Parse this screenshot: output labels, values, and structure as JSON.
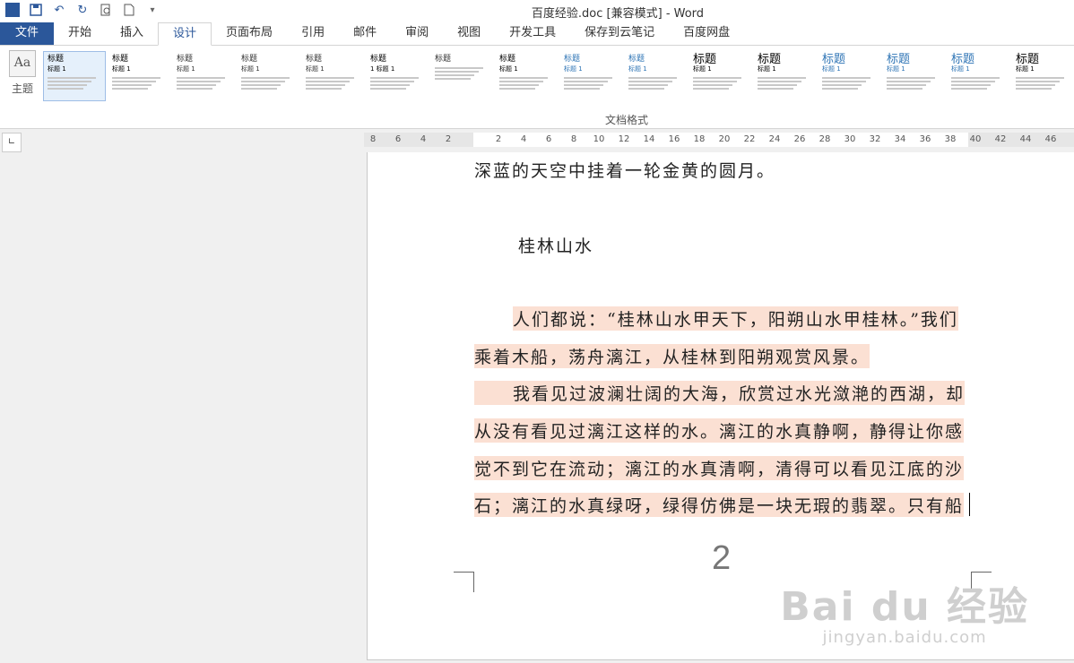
{
  "window": {
    "title": "百度经验.doc [兼容模式] - Word"
  },
  "qat": {
    "icons": [
      "word-logo",
      "save-icon",
      "undo-icon",
      "redo-icon",
      "print-preview-icon",
      "new-doc-icon",
      "customize-icon"
    ]
  },
  "tabs": [
    "文件",
    "开始",
    "插入",
    "设计",
    "页面布局",
    "引用",
    "邮件",
    "审阅",
    "视图",
    "开发工具",
    "保存到云笔记",
    "百度网盘"
  ],
  "ribbon": {
    "theme_label": "主题",
    "theme_glyph": "Aa",
    "group_label": "文档格式",
    "styles": [
      {
        "title": "标题",
        "sub": "标题 1"
      },
      {
        "title": "标题",
        "sub": "标题 1"
      },
      {
        "title": "标题",
        "sub": "标题 1"
      },
      {
        "title": "标题",
        "sub": "标题 1"
      },
      {
        "title": "标题",
        "sub": "标题 1"
      },
      {
        "title": "标题",
        "sub": "1 标题 1"
      },
      {
        "title": "标题",
        "sub": ""
      },
      {
        "title": "标题",
        "sub": "标题 1"
      },
      {
        "title": "标题",
        "sub": "标题 1"
      },
      {
        "title": "标题",
        "sub": "标题 1"
      },
      {
        "title": "标题",
        "sub": "标题 1"
      },
      {
        "title": "标题",
        "sub": "标题 1"
      },
      {
        "title": "标题",
        "sub": "标题 1"
      },
      {
        "title": "标题",
        "sub": "标题 1"
      },
      {
        "title": "标题",
        "sub": "标题 1"
      },
      {
        "title": "标题",
        "sub": "标题 1"
      }
    ]
  },
  "ruler": {
    "ticks": [
      "8",
      "6",
      "4",
      "2",
      "",
      "2",
      "4",
      "6",
      "8",
      "10",
      "12",
      "14",
      "16",
      "18",
      "20",
      "22",
      "24",
      "26",
      "28",
      "30",
      "32",
      "34",
      "36",
      "38",
      "40",
      "42",
      "44",
      "46"
    ]
  },
  "document": {
    "line1": "深蓝的天空中挂着一轮金黄的圆月。",
    "heading": "桂林山水",
    "p1a": "人们都说：“桂林山水甲天下，阳朔山水甲桂林。”我们",
    "p1b": "乘着木船，荡舟漓江，从桂林到阳朔观赏风景。",
    "p2a": "我看见过波澜壮阔的大海，欣赏过水光潋滟的西湖，却",
    "p2b": "从没有看见过漓江这样的水。漓江的水真静啊，静得让你感",
    "p2c": "觉不到它在流动；漓江的水真清啊，清得可以看见江底的沙",
    "p2d": "石；漓江的水真绿呀，绿得仿佛是一块无瑕的翡翠。只有船",
    "page_number": "2"
  },
  "watermark": {
    "brand": "Bai du 经验",
    "url": "jingyan.baidu.com"
  }
}
